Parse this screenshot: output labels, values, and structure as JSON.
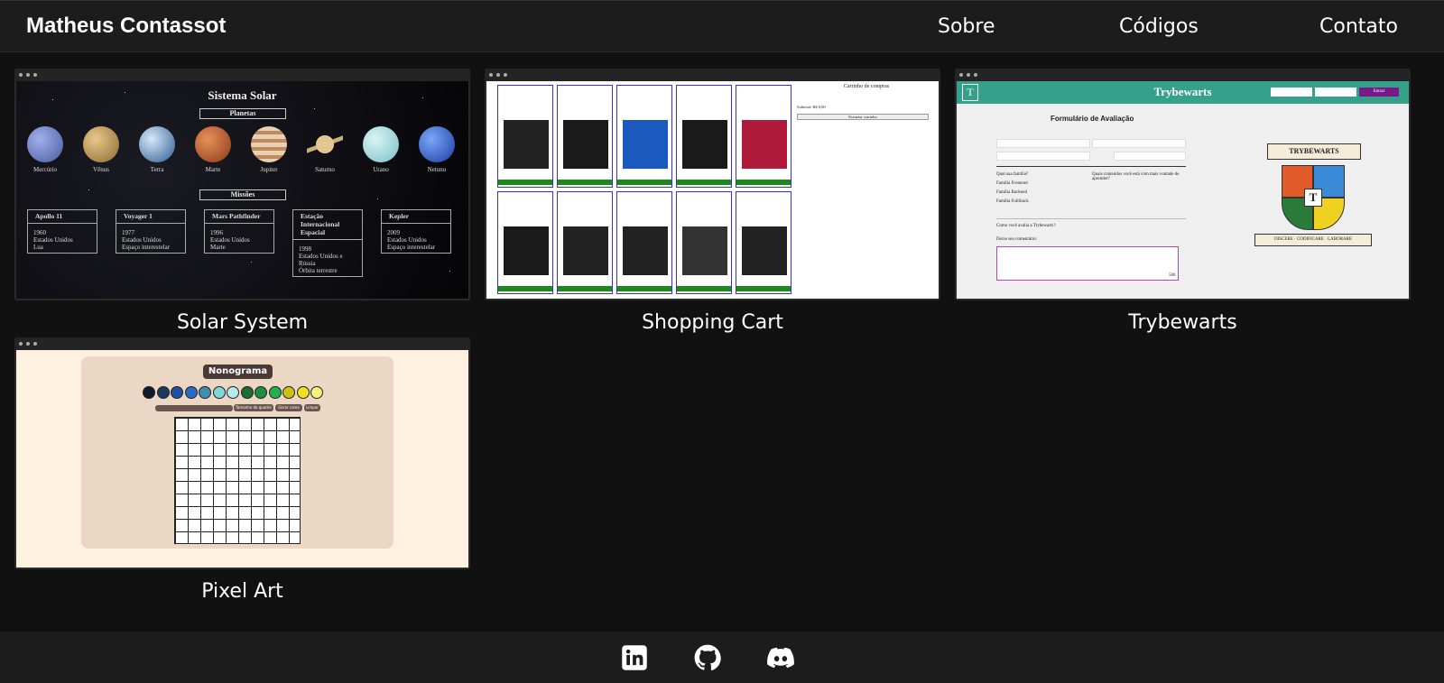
{
  "header": {
    "brand": "Matheus Contassot",
    "nav": [
      "Sobre",
      "Códigos",
      "Contato"
    ]
  },
  "projects": [
    {
      "caption": "Solar System",
      "preview": {
        "title": "Sistema Solar",
        "planets_label": "Planetas",
        "planets": [
          "Mercúrio",
          "Vênus",
          "Terra",
          "Marte",
          "Jupiter",
          "Saturno",
          "Urano",
          "Netuno"
        ],
        "missions_label": "Missões",
        "missions": [
          {
            "name": "Apollo 11",
            "year": "1960",
            "country": "Estados Unidos",
            "dest": "Lua"
          },
          {
            "name": "Voyager 1",
            "year": "1977",
            "country": "Estados Unidos",
            "dest": "Espaço interestelar"
          },
          {
            "name": "Mars Pathfinder",
            "year": "1996",
            "country": "Estados Unidos",
            "dest": "Marte"
          },
          {
            "name": "Estação Internacional Espacial",
            "year": "1998",
            "country": "Estados Unidos e Rússia",
            "dest": "Órbita terrestre"
          },
          {
            "name": "Kepler",
            "year": "2009",
            "country": "Estados Unidos",
            "dest": "Espaço interestelar"
          }
        ]
      }
    },
    {
      "caption": "Shopping Cart",
      "preview": {
        "cart_title": "Carrinho de compras",
        "subtotal": "Subtotal: R$ 0,00",
        "empty_button": "Esvaziar carrinho"
      }
    },
    {
      "caption": "Trybewarts",
      "preview": {
        "title": "Trybewarts",
        "form_title": "Formulário de Avaliação",
        "login_button": "Entrar",
        "house_question": "Qual sua família?",
        "families": [
          "Família Frontend",
          "Família Backend",
          "Família FullStack"
        ],
        "learn_question": "Quais conteúdos você está com mais vontade de aprender?",
        "rating_question": "Como você avalia a Trybewarts?",
        "comment_label": "Deixe seu comentário:",
        "counter": "500",
        "crest_title": "TRYBEWARTS",
        "crest_motto": "DISCERE · CODIFICARE · LABORARE"
      }
    },
    {
      "caption": "Pixel Art",
      "preview": {
        "title": "Nonograma",
        "buttons": [
          "Tamanho do quadro",
          "Gerar cores",
          "Limpar"
        ],
        "palette": [
          "#0d1b2a",
          "#1b3a5c",
          "#1e4fa0",
          "#2a6cc4",
          "#3d8fb0",
          "#7fd6d6",
          "#b4ecec",
          "#1f6b35",
          "#1e8f3e",
          "#24b04f",
          "#c9c20f",
          "#f0e020",
          "#f5f27a"
        ]
      }
    }
  ],
  "footer": {
    "icons": [
      "linkedin-icon",
      "github-icon",
      "discord-icon"
    ]
  }
}
